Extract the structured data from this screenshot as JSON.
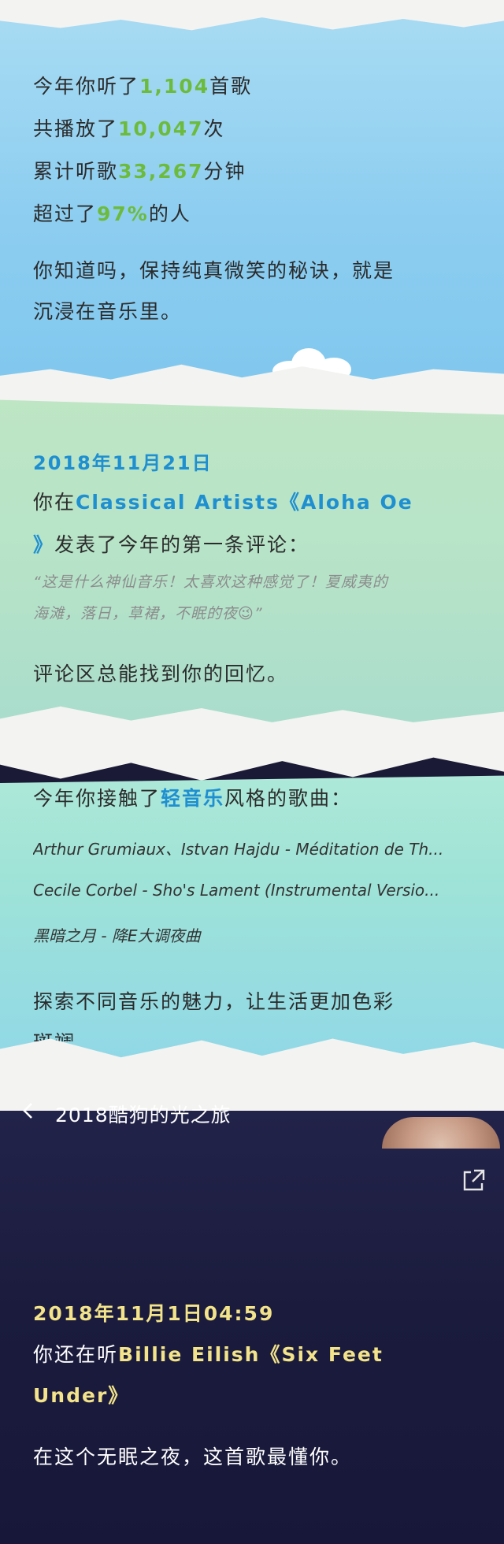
{
  "stats": {
    "songs_prefix": "今年你听了",
    "songs_value": "1,104",
    "songs_suffix": "首歌",
    "plays_prefix": "共播放了",
    "plays_value": "10,047",
    "plays_suffix": "次",
    "minutes_prefix": "累计听歌",
    "minutes_value": "33,267",
    "minutes_suffix": "分钟",
    "rank_prefix": "超过了",
    "rank_value": "97%",
    "rank_suffix": "的人",
    "quote_line1": "你知道吗，保持纯真微笑的秘诀，就是",
    "quote_line2": "沉浸在音乐里。"
  },
  "comment": {
    "date": "2018年11月21日",
    "line1_prefix": "你在",
    "line1_song": "Classical Artists《Aloha Oe",
    "line2_song_end": "》",
    "line2_suffix": "发表了今年的第一条评论：",
    "quote_line1": "“这是什么神仙音乐！太喜欢这种感觉了！夏威夷的",
    "quote_line2": "海滩，落日，草裙，不眠的夜😉”",
    "footer": "评论区总能找到你的回忆。"
  },
  "genre": {
    "intro_prefix": "今年你接触了",
    "intro_genre": "轻音乐",
    "intro_suffix": "风格的歌曲：",
    "songs": [
      "Arthur Grumiaux、Istvan Hajdu - Méditation de Th...",
      "Cecile Corbel - Sho's Lament (Instrumental Versio...",
      "黑暗之月 - 降E大调夜曲"
    ],
    "footer_line1": "探索不同音乐的魅力，让生活更加色彩",
    "footer_line2": "斑斓"
  },
  "nav": {
    "title": "2018酷狗的光之旅",
    "back_icon": "chevron-left-icon",
    "share_icon": "share-icon"
  },
  "late_night": {
    "datetime": "2018年11月1日04:59",
    "line1_prefix": "你还在听",
    "line1_song": "Billie Eilish《Six Feet",
    "line2_song": "Under》",
    "footer": "在这个无眠之夜，这首歌最懂你。"
  },
  "colors": {
    "highlight_green": "#6dbb3c",
    "highlight_blue": "#1e8fd0",
    "highlight_yellow": "#f3e38a"
  }
}
